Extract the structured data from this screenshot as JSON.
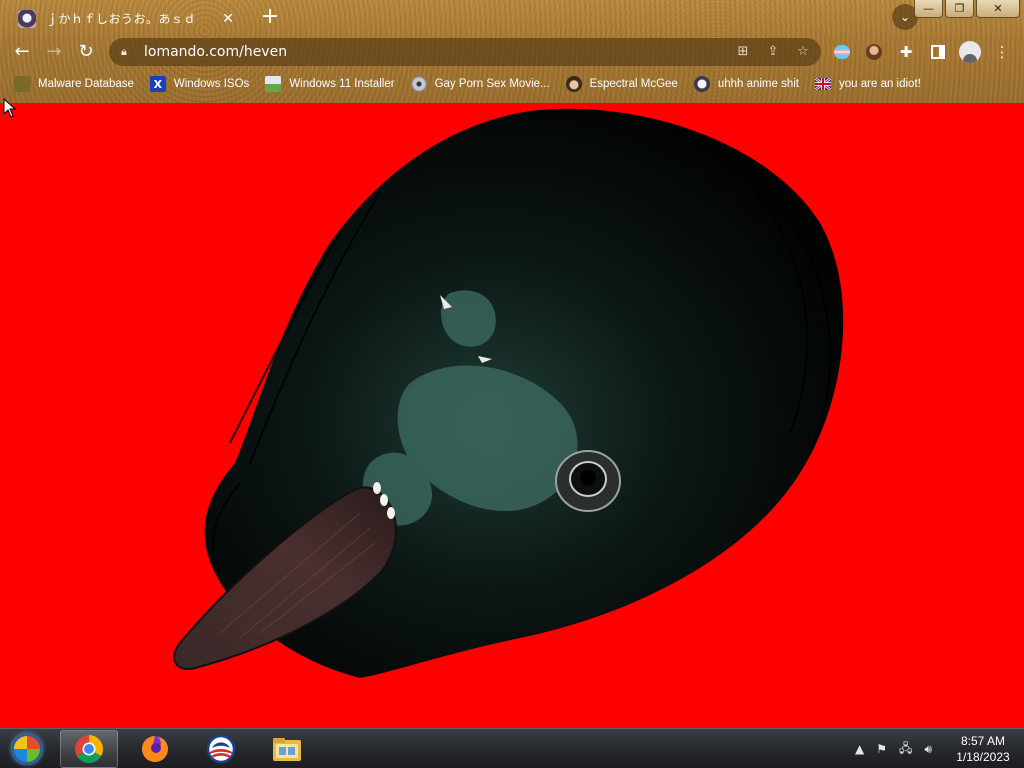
{
  "browser": {
    "tab": {
      "title": "ｊかｈｆしおうお。あｓｄ"
    },
    "url": "lomando.com/heven",
    "window_controls": {
      "minimize": "—",
      "maximize": "❐",
      "close": "✕"
    }
  },
  "bookmarks": [
    {
      "label": "Malware Database",
      "icon": "malware-database-icon"
    },
    {
      "label": "Windows ISOs",
      "icon": "x-logo-icon"
    },
    {
      "label": "Windows 11 Installer",
      "icon": "image-thumbnail-icon"
    },
    {
      "label": "Gay Porn Sex Movie...",
      "icon": "cd-icon"
    },
    {
      "label": "Espectral McGee",
      "icon": "character-face-icon"
    },
    {
      "label": "uhhh anime shit",
      "icon": "anime-face-icon"
    },
    {
      "label": "you are an idiot!",
      "icon": "uk-flag-icon"
    }
  ],
  "page": {
    "background": "#ff0000"
  },
  "taskbar": {
    "clock": {
      "time": "8:57 AM",
      "date": "1/18/2023"
    },
    "apps": [
      "chrome-icon",
      "firefox-icon",
      "obama-logo-icon",
      "file-explorer-icon"
    ]
  }
}
